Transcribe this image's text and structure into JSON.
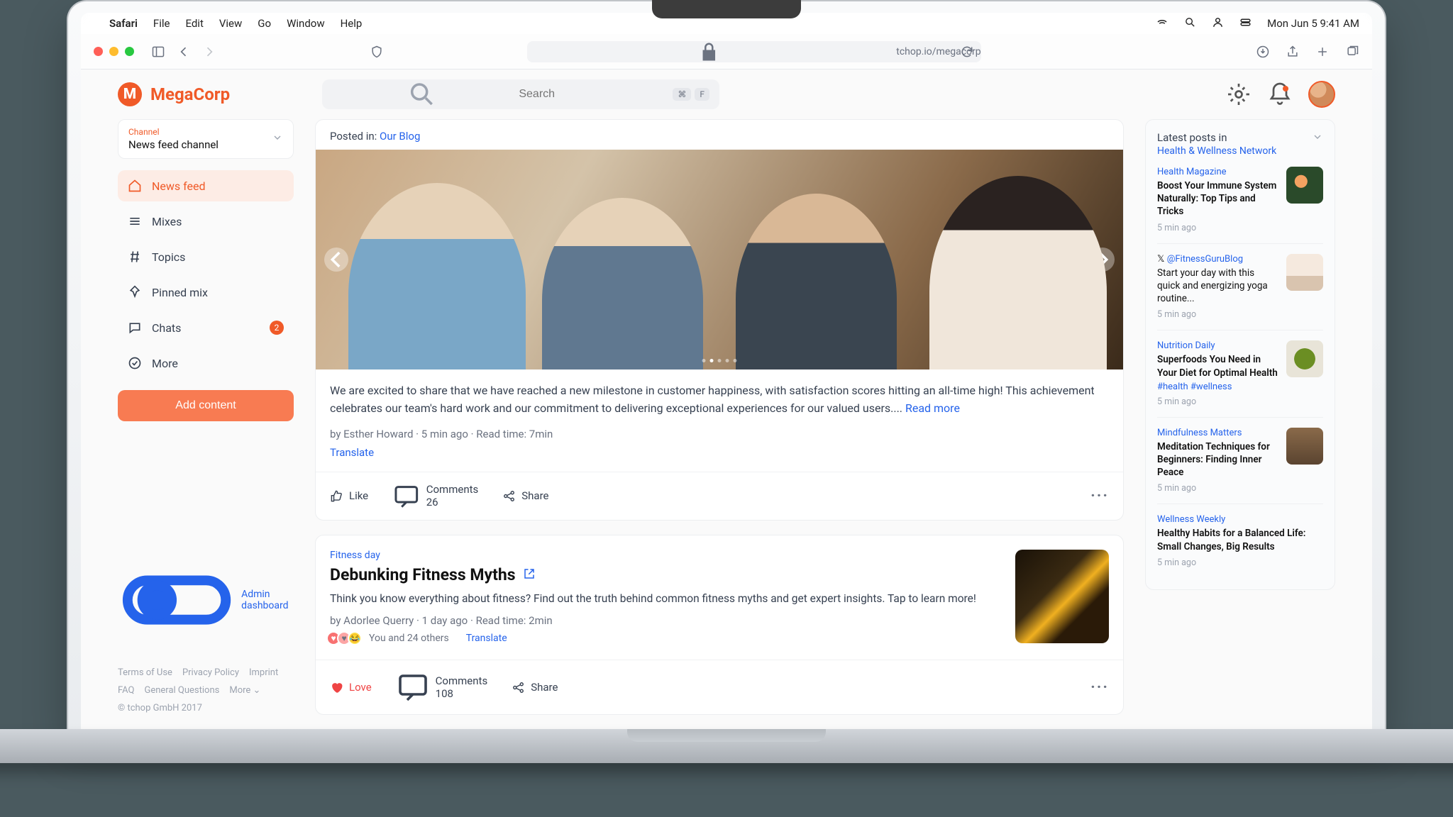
{
  "macbar": {
    "app": "Safari",
    "menus": [
      "File",
      "Edit",
      "View",
      "Go",
      "Window",
      "Help"
    ],
    "clock": "Mon Jun 5  9:41 AM"
  },
  "safari": {
    "url": "tchop.io/megacorp"
  },
  "header": {
    "brand": "MegaCorp",
    "search_placeholder": "Search",
    "kbd1": "⌘",
    "kbd2": "F"
  },
  "channel": {
    "label": "Channel",
    "name": "News feed channel"
  },
  "nav": {
    "newsfeed": "News feed",
    "mixes": "Mixes",
    "topics": "Topics",
    "pinned": "Pinned mix",
    "chats": "Chats",
    "chats_badge": "2",
    "more": "More",
    "add": "Add content"
  },
  "footer": {
    "admin": "Admin dashboard",
    "links": [
      "Terms of Use",
      "Privacy Policy",
      "Imprint",
      "FAQ",
      "General Questions",
      "More ⌄"
    ],
    "copyright": "© tchop GmbH 2017"
  },
  "post1": {
    "posted_label": "Posted in:",
    "posted_link": "Our Blog",
    "body": "We are excited to share that we have reached a new milestone in customer happiness, with satisfaction scores hitting an all-time high! This achievement celebrates our team's hard work and our commitment to delivering exceptional experiences for our valued users....",
    "readmore": "Read more",
    "meta": "by Esther Howard · 5 min ago · Read time: 7min",
    "translate": "Translate",
    "like": "Like",
    "comments": "Comments 26",
    "share": "Share"
  },
  "post2": {
    "cat": "Fitness day",
    "title": "Debunking Fitness Myths",
    "body": "Think you know everything about fitness? Find out the truth behind common fitness myths and get expert insights. Tap to learn more!",
    "meta": "by Adorlee Querry · 1 day ago · Read time: 2min",
    "reacts": "You and 24 others",
    "translate": "Translate",
    "love": "Love",
    "comments": "Comments 108",
    "share": "Share"
  },
  "rail": {
    "title": "Latest posts in",
    "subtitle": "Health & Wellness Network",
    "items": [
      {
        "src": "Health Magazine",
        "title": "Boost Your Immune System Naturally: Top Tips and Tricks",
        "time": "5 min ago"
      },
      {
        "src": "@FitnessGuruBlog",
        "title": "Start your day with this quick and energizing yoga routine...",
        "time": "5 min ago"
      },
      {
        "src": "Nutrition Daily",
        "title": "Superfoods You Need in Your Diet for Optimal Health",
        "tags": "#health #wellness",
        "time": "5 min ago"
      },
      {
        "src": "Mindfulness Matters",
        "title": "Meditation Techniques for Beginners: Finding Inner Peace",
        "time": "5 min ago"
      },
      {
        "src": "Wellness Weekly",
        "title": "Healthy Habits for a Balanced Life: Small Changes, Big Results",
        "time": "5 min ago"
      }
    ]
  }
}
